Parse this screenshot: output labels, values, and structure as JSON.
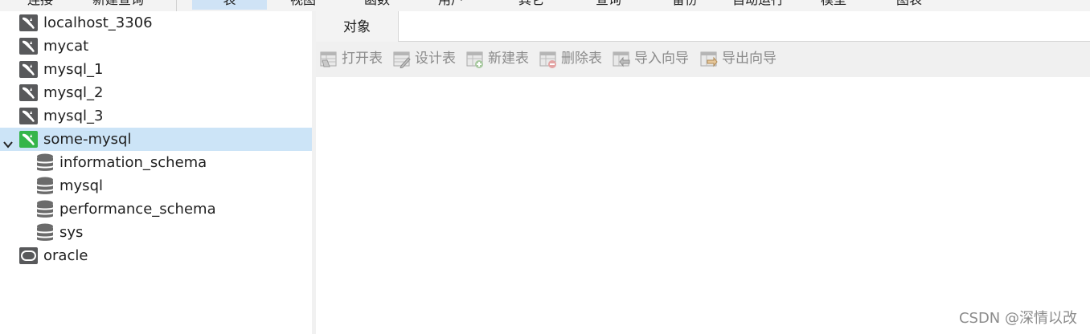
{
  "menu": {
    "items": [
      "连接",
      "新建查询",
      "表",
      "视图",
      "函数",
      "用户",
      "其它",
      "查询",
      "备份",
      "自动运行",
      "模型",
      "图表"
    ],
    "active_index": 2
  },
  "tree": {
    "connections": [
      {
        "label": "localhost_3306",
        "icon": "mysql-connection-icon"
      },
      {
        "label": "mycat",
        "icon": "mysql-connection-icon"
      },
      {
        "label": "mysql_1",
        "icon": "mysql-connection-icon"
      },
      {
        "label": "mysql_2",
        "icon": "mysql-connection-icon"
      },
      {
        "label": "mysql_3",
        "icon": "mysql-connection-icon"
      },
      {
        "label": "some-mysql",
        "icon": "mysql-connection-open-icon",
        "expanded": true,
        "selected": true
      },
      {
        "label": "oracle",
        "icon": "oracle-connection-icon"
      }
    ],
    "databases": [
      {
        "label": "information_schema",
        "icon": "database-icon"
      },
      {
        "label": "mysql",
        "icon": "database-icon"
      },
      {
        "label": "performance_schema",
        "icon": "database-icon"
      },
      {
        "label": "sys",
        "icon": "database-icon"
      }
    ]
  },
  "tabs": {
    "objects": "对象"
  },
  "toolbar": {
    "open_table": "打开表",
    "design_table": "设计表",
    "new_table": "新建表",
    "delete_table": "删除表",
    "import_wizard": "导入向导",
    "export_wizard": "导出向导"
  },
  "watermark": "CSDN @深情以改",
  "colors": {
    "selected_row": "#cce4f7",
    "active_menu": "#cfe3f6",
    "toolbar_bg": "#f0f0f0",
    "mysql_open": "#35b54a",
    "mysql_closed": "#58595b"
  }
}
